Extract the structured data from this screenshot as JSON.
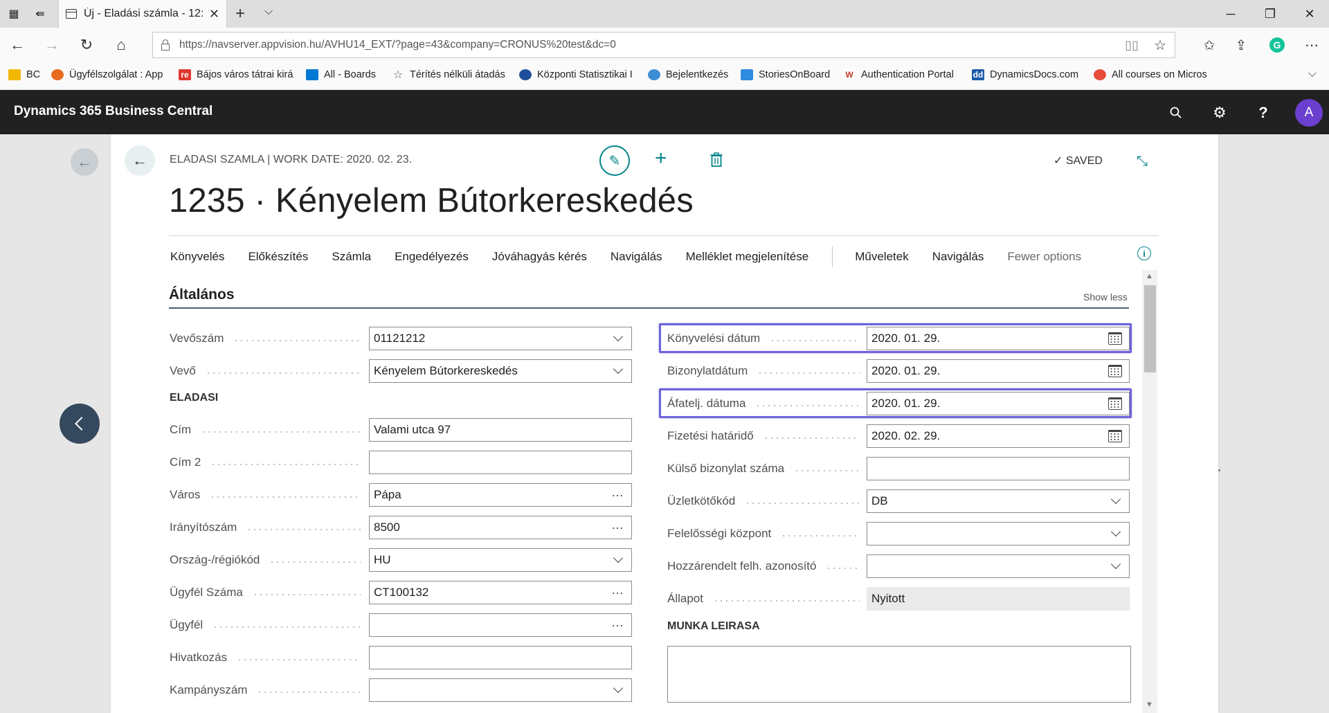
{
  "browser": {
    "tab_title": "Új - Eladási számla - 12:",
    "url": "https://navserver.appvision.hu/AVHU14_EXT/?page=43&company=CRONUS%20test&dc=0",
    "favorites": [
      {
        "label": "BC",
        "color": "#f2b705"
      },
      {
        "label": "Ügyfélszolgálat : App",
        "color": "#e86a1e"
      },
      {
        "label": "Bájos város tátrai kirá",
        "color": "#e0372f"
      },
      {
        "label": "All - Boards",
        "color": "#0078d4"
      },
      {
        "label": "Térítés nélküli átadás",
        "color": "#555555"
      },
      {
        "label": "Központi Statisztikai I",
        "color": "#1f4e9c"
      },
      {
        "label": "Bejelentkezés",
        "color": "#3c8fd6"
      },
      {
        "label": "StoriesOnBoard",
        "color": "#2d8ce0"
      },
      {
        "label": "Authentication Portal",
        "color": "#c0392b"
      },
      {
        "label": "DynamicsDocs.com",
        "color": "#1e5aa8"
      },
      {
        "label": "All courses on Micros",
        "color": "#e74c3c"
      }
    ]
  },
  "app": {
    "title": "Dynamics 365 Business Central",
    "avatar_letter": "A"
  },
  "page": {
    "breadcrumb": "ELADASI SZAMLA | WORK DATE: 2020. 02. 23.",
    "saved_label": "SAVED",
    "title": "1235 · Kényelem Bútorkereskedés",
    "actions": [
      "Könyvelés",
      "Előkészítés",
      "Számla",
      "Engedélyezés",
      "Jóváhagyás kérés",
      "Navigálás",
      "Melléklet megjelenítése"
    ],
    "actions_right": [
      "Műveletek",
      "Navigálás"
    ],
    "fewer_options": "Fewer options",
    "section_title": "Általános",
    "show_less": "Show less",
    "group_eladasi": "ELADASI",
    "group_munka": "MUNKA LEIRASA"
  },
  "left_fields": [
    {
      "label": "Vevőszám",
      "value": "01121212",
      "control": "dropdown"
    },
    {
      "label": "Vevő",
      "value": "Kényelem Bútorkereskedés",
      "control": "dropdown"
    },
    {
      "label": "Cím",
      "value": "Valami  utca  97",
      "control": "text"
    },
    {
      "label": "Cím 2",
      "value": "",
      "control": "text"
    },
    {
      "label": "Város",
      "value": "Pápa",
      "control": "lookup"
    },
    {
      "label": "Irányítószám",
      "value": "8500",
      "control": "lookup"
    },
    {
      "label": "Ország-/régiókód",
      "value": "HU",
      "control": "dropdown"
    },
    {
      "label": "Ügyfél Száma",
      "value": "CT100132",
      "control": "lookup"
    },
    {
      "label": "Ügyfél",
      "value": "",
      "control": "lookup"
    },
    {
      "label": "Hivatkozás",
      "value": "",
      "control": "text"
    },
    {
      "label": "Kampányszám",
      "value": "",
      "control": "dropdown"
    }
  ],
  "right_fields": [
    {
      "label": "Könyvelési dátum",
      "value": "2020. 01. 29.",
      "control": "date",
      "highlighted": true
    },
    {
      "label": "Bizonylatdátum",
      "value": "2020. 01. 29.",
      "control": "date",
      "highlighted": false
    },
    {
      "label": "Áfatelj. dátuma",
      "value": "2020. 01. 29.",
      "control": "date",
      "highlighted": true
    },
    {
      "label": "Fizetési határidő",
      "value": "2020. 02. 29.",
      "control": "date",
      "highlighted": false
    },
    {
      "label": "Külső bizonylat száma",
      "value": "",
      "control": "text",
      "highlighted": false
    },
    {
      "label": "Üzletkötőkód",
      "value": "DB",
      "control": "dropdown",
      "highlighted": false
    },
    {
      "label": "Felelősségi központ",
      "value": "",
      "control": "dropdown",
      "highlighted": false
    },
    {
      "label": "Hozzárendelt felh. azonosító",
      "value": "",
      "control": "dropdown",
      "highlighted": false
    },
    {
      "label": "Állapot",
      "value": "Nyitott",
      "control": "readonly",
      "highlighted": false
    }
  ],
  "colors": {
    "accent": "#008489",
    "highlight": "#6e63dd",
    "header": "#212121",
    "avatar": "#6b3fcf"
  }
}
